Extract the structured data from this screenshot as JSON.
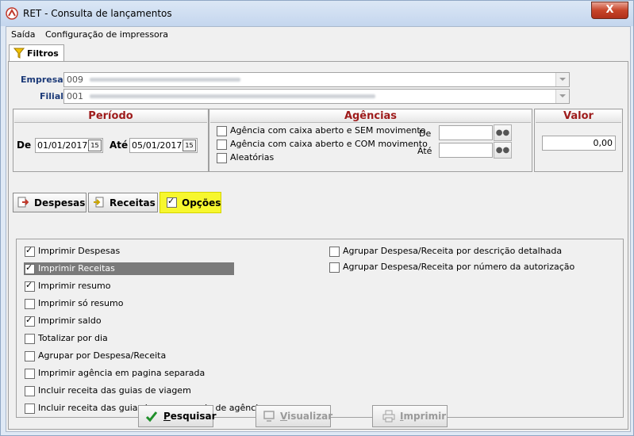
{
  "window": {
    "title": "RET - Consulta de lançamentos",
    "close_label": "X"
  },
  "menu": {
    "items": [
      "Saída",
      "Configuração de impressora"
    ]
  },
  "tabs": {
    "filtros_label": "Filtros"
  },
  "filters": {
    "empresa_label": "Empresa",
    "empresa_value": "009",
    "filial_label": "Filial",
    "filial_value": "001"
  },
  "periodo": {
    "title": "Período",
    "de_label": "De",
    "de_value": "01/01/2017",
    "ate_label": "Até",
    "ate_value": "05/01/2017",
    "cal_glyph": "15"
  },
  "agencias": {
    "title": "Agências",
    "options": [
      {
        "label": "Agência com caixa aberto e SEM movimento",
        "checked": false
      },
      {
        "label": "Agência com caixa aberto e COM movimento",
        "checked": false
      },
      {
        "label": "Aleatórias",
        "checked": false
      }
    ],
    "de_label": "De",
    "ate_label": "Até",
    "de_value": "",
    "ate_value": ""
  },
  "valor": {
    "title": "Valor",
    "value": "0,00"
  },
  "section_buttons": {
    "despesas": "Despesas",
    "receitas": "Receitas",
    "opcoes": "Opções"
  },
  "options_left": [
    {
      "label": "Imprimir Despesas",
      "checked": true
    },
    {
      "label": "Imprimir Receitas",
      "checked": true
    },
    {
      "label": "Imprimir resumo",
      "checked": true
    },
    {
      "label": "Imprimir só resumo",
      "checked": false
    },
    {
      "label": "Imprimir saldo",
      "checked": true
    },
    {
      "label": "Totalizar por dia",
      "checked": false
    },
    {
      "label": "Agrupar por Despesa/Receita",
      "checked": false
    },
    {
      "label": "Imprimir agência em pagina separada",
      "checked": false
    },
    {
      "label": "Incluir receita das guias de viagem",
      "checked": false
    },
    {
      "label": "Incluir receita das guias imp. como guia de agência",
      "checked": false
    }
  ],
  "options_right": [
    {
      "label": "Agrupar Despesa/Receita por descrição detalhada",
      "checked": false
    },
    {
      "label": "Agrupar Despesa/Receita por número da autorização",
      "checked": false
    }
  ],
  "bottom_buttons": {
    "pesquisar_first": "P",
    "pesquisar_rest": "esquisar",
    "visualizar_first": "V",
    "visualizar_rest": "isualizar",
    "imprimir_first": "I",
    "imprimir_rest": "mprimir"
  },
  "colors": {
    "accent_yellow": "#f7f72e",
    "section_red": "#9e1b1b",
    "label_blue": "#1c3a78"
  }
}
